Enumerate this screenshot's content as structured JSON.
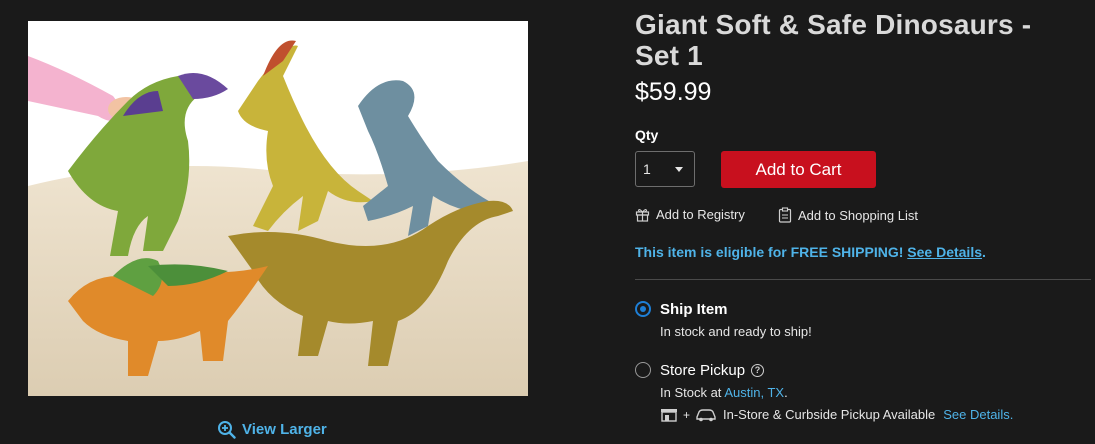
{
  "product": {
    "image_alt": "Giant soft dinosaur toys on sand",
    "view_larger": "View Larger",
    "title": "Giant Soft & Safe Dinosaurs - Set 1",
    "price": "$59.99"
  },
  "purchase": {
    "qty_label": "Qty",
    "qty_value": "1",
    "add_to_cart": "Add to Cart",
    "add_to_registry": "Add to Registry",
    "add_to_list": "Add to Shopping List"
  },
  "shipping": {
    "note": "This item is eligible for FREE SHIPPING!",
    "details_link": "See Details",
    "period": "."
  },
  "fulfillment": {
    "ship": {
      "label": "Ship Item",
      "status": "In stock and ready to ship!",
      "selected": true
    },
    "pickup": {
      "label": "Store Pickup",
      "help": "?",
      "stock_prefix": "In Stock at",
      "store": "Austin, TX",
      "period": ".",
      "curbside": "In-Store & Curbside Pickup Available",
      "details_link": "See Details.",
      "selected": false
    }
  },
  "colors": {
    "accent_blue": "#4fb3e8",
    "cart_red": "#c8101e",
    "radio_blue": "#1e7fd6",
    "background": "#1a1a1a"
  },
  "icons": [
    "zoom-in-icon",
    "gift-icon",
    "clipboard-icon",
    "help-icon",
    "store-icon",
    "car-icon",
    "chevron-down-icon"
  ]
}
